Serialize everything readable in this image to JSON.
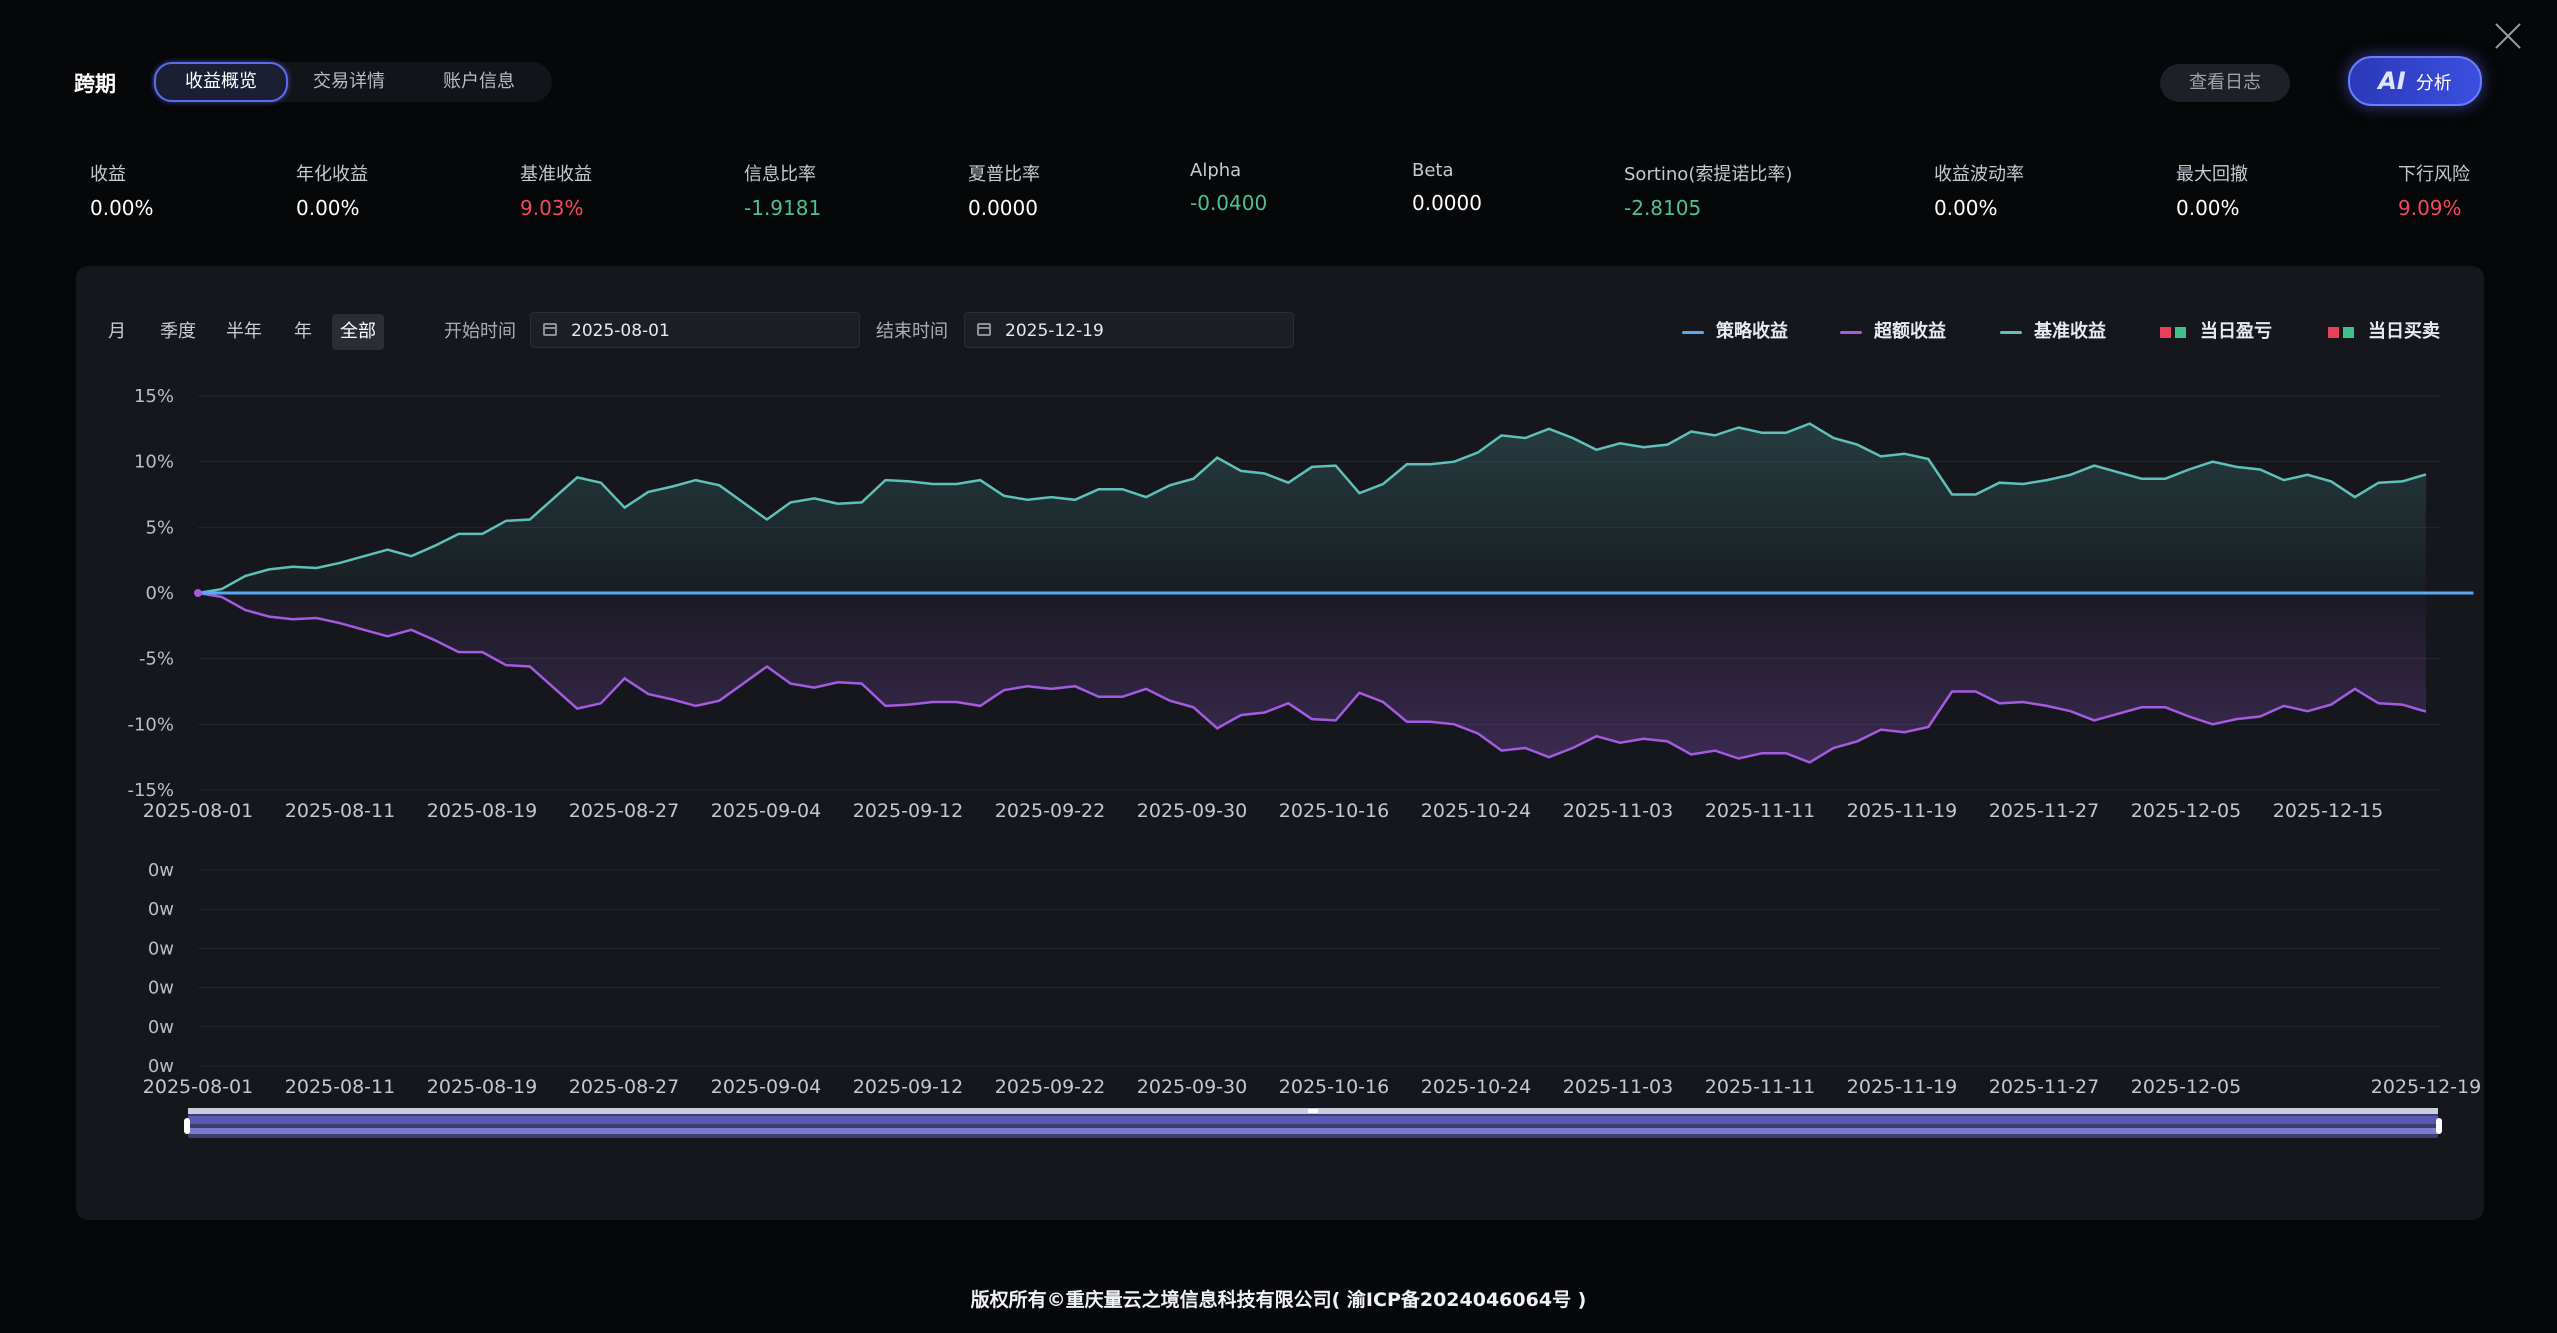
{
  "header": {
    "title": "跨期",
    "tabs": [
      {
        "label": "收益概览",
        "active": true
      },
      {
        "label": "交易详情",
        "active": false
      },
      {
        "label": "账户信息",
        "active": false
      }
    ],
    "log_button": "查看日志",
    "ai_button": {
      "icon_text": "AI",
      "label": "分析"
    }
  },
  "metrics": [
    {
      "label": "收益",
      "value": "0.00%",
      "color": "#ffffff"
    },
    {
      "label": "年化收益",
      "value": "0.00%",
      "color": "#ffffff"
    },
    {
      "label": "基准收益",
      "value": "9.03%",
      "color": "#f2495c"
    },
    {
      "label": "信息比率",
      "value": "-1.9181",
      "color": "#4ec18e"
    },
    {
      "label": "夏普比率",
      "value": "0.0000",
      "color": "#ffffff"
    },
    {
      "label": "Alpha",
      "value": "-0.0400",
      "color": "#4ec18e"
    },
    {
      "label": "Beta",
      "value": "0.0000",
      "color": "#ffffff"
    },
    {
      "label": "Sortino(索提诺比率)",
      "value": "-2.8105",
      "color": "#4ec18e"
    },
    {
      "label": "收益波动率",
      "value": "0.00%",
      "color": "#ffffff"
    },
    {
      "label": "最大回撤",
      "value": "0.00%",
      "color": "#ffffff"
    },
    {
      "label": "下行风险",
      "value": "9.09%",
      "color": "#f2495c"
    }
  ],
  "controls": {
    "ranges": [
      {
        "label": "月",
        "active": false
      },
      {
        "label": "季度",
        "active": false
      },
      {
        "label": "半年",
        "active": false
      },
      {
        "label": "年",
        "active": false
      },
      {
        "label": "全部",
        "active": true
      }
    ],
    "start_label": "开始时间",
    "start_value": "2025-08-01",
    "end_label": "结束时间",
    "end_value": "2025-12-19"
  },
  "legend": [
    {
      "label": "策略收益",
      "kind": "line",
      "color": "#5aa9f0"
    },
    {
      "label": "超额收益",
      "kind": "line",
      "color": "#a35be0"
    },
    {
      "label": "基准收益",
      "kind": "line",
      "color": "#5fc0b8"
    },
    {
      "label": "当日盈亏",
      "kind": "squares",
      "colors": [
        "#e9405a",
        "#3fbf8a"
      ]
    },
    {
      "label": "当日买卖",
      "kind": "squares",
      "colors": [
        "#e9405a",
        "#3fbf8a"
      ]
    }
  ],
  "chart_data": [
    {
      "type": "line",
      "y_ticks": [
        "15%",
        "10%",
        "5%",
        "0%",
        "-5%",
        "-10%",
        "-15%"
      ],
      "ylim": [
        -15,
        15
      ],
      "x_tick_labels": [
        "2025-08-01",
        "2025-08-11",
        "2025-08-19",
        "2025-08-27",
        "2025-09-04",
        "2025-09-12",
        "2025-09-22",
        "2025-09-30",
        "2025-10-16",
        "2025-10-24",
        "2025-11-03",
        "2025-11-11",
        "2025-11-19",
        "2025-11-27",
        "2025-12-05",
        "2025-12-15"
      ],
      "series": [
        {
          "name": "策略收益",
          "color": "#5aa9f0",
          "values": [
            0,
            0,
            0,
            0,
            0,
            0,
            0,
            0,
            0,
            0,
            0,
            0,
            0,
            0,
            0,
            0,
            0,
            0,
            0,
            0,
            0,
            0,
            0,
            0,
            0,
            0,
            0,
            0,
            0,
            0,
            0,
            0,
            0,
            0,
            0,
            0,
            0,
            0,
            0,
            0,
            0,
            0,
            0,
            0,
            0,
            0,
            0,
            0,
            0,
            0,
            0,
            0,
            0,
            0,
            0,
            0,
            0,
            0,
            0,
            0,
            0,
            0,
            0,
            0,
            0,
            0,
            0,
            0,
            0,
            0,
            0,
            0,
            0,
            0,
            0,
            0,
            0,
            0,
            0,
            0,
            0,
            0,
            0,
            0,
            0,
            0,
            0,
            0,
            0,
            0,
            0,
            0,
            0,
            0,
            0,
            0,
            0
          ]
        },
        {
          "name": "基准收益",
          "color": "#5fc0b8",
          "values": [
            0,
            0.3,
            1.3,
            1.8,
            2,
            1.9,
            2.3,
            2.8,
            3.3,
            2.8,
            3.6,
            4.5,
            4.5,
            5.5,
            5.6,
            7.2,
            8.8,
            8.4,
            6.5,
            7.7,
            8.1,
            8.6,
            8.2,
            6.9,
            5.6,
            6.9,
            7.2,
            6.8,
            6.9,
            8.6,
            8.5,
            8.3,
            8.3,
            8.6,
            7.4,
            7.1,
            7.3,
            7.1,
            7.9,
            7.9,
            7.3,
            8.2,
            8.7,
            10.3,
            9.3,
            9.1,
            8.4,
            9.6,
            9.7,
            7.6,
            8.3,
            9.8,
            9.8,
            10,
            10.7,
            12,
            11.8,
            12.5,
            11.8,
            10.9,
            11.4,
            11.1,
            11.3,
            12.3,
            12,
            12.6,
            12.2,
            12.2,
            12.9,
            11.8,
            11.3,
            10.4,
            10.6,
            10.2,
            7.5,
            7.5,
            8.4,
            8.3,
            8.6,
            9,
            9.7,
            9.2,
            8.7,
            8.7,
            9.4,
            10,
            9.6,
            9.4,
            8.6,
            9,
            8.5,
            7.3,
            8.4,
            8.5,
            9.03
          ]
        },
        {
          "name": "超额收益",
          "color": "#a35be0",
          "values": [
            0,
            -0.3,
            -1.3,
            -1.8,
            -2,
            -1.9,
            -2.3,
            -2.8,
            -3.3,
            -2.8,
            -3.6,
            -4.5,
            -4.5,
            -5.5,
            -5.6,
            -7.2,
            -8.8,
            -8.4,
            -6.5,
            -7.7,
            -8.1,
            -8.6,
            -8.2,
            -6.9,
            -5.6,
            -6.9,
            -7.2,
            -6.8,
            -6.9,
            -8.6,
            -8.5,
            -8.3,
            -8.3,
            -8.6,
            -7.4,
            -7.1,
            -7.3,
            -7.1,
            -7.9,
            -7.9,
            -7.3,
            -8.2,
            -8.7,
            -10.3,
            -9.3,
            -9.1,
            -8.4,
            -9.6,
            -9.7,
            -7.6,
            -8.3,
            -9.8,
            -9.8,
            -10,
            -10.7,
            -12,
            -11.8,
            -12.5,
            -11.8,
            -10.9,
            -11.4,
            -11.1,
            -11.3,
            -12.3,
            -12,
            -12.6,
            -12.2,
            -12.2,
            -12.9,
            -11.8,
            -11.3,
            -10.4,
            -10.6,
            -10.2,
            -7.5,
            -7.5,
            -8.4,
            -8.3,
            -8.6,
            -9,
            -9.7,
            -9.2,
            -8.7,
            -8.7,
            -9.4,
            -10,
            -9.6,
            -9.4,
            -8.6,
            -9,
            -8.5,
            -7.3,
            -8.4,
            -8.5,
            -9.03
          ]
        }
      ]
    },
    {
      "type": "bar",
      "y_ticks": [
        "0w",
        "0w",
        "0w",
        "0w",
        "0w",
        "0w"
      ],
      "x_tick_labels": [
        "2025-08-01",
        "2025-08-11",
        "2025-08-19",
        "2025-08-27",
        "2025-09-04",
        "2025-09-12",
        "2025-09-22",
        "2025-09-30",
        "2025-10-16",
        "2025-10-24",
        "2025-11-03",
        "2025-11-11",
        "2025-11-19",
        "2025-11-27",
        "2025-12-05",
        "2025-12-19"
      ],
      "series": []
    }
  ],
  "footer": "版权所有©重庆量云之境信息科技有限公司( 渝ICP备2024046064号 )"
}
